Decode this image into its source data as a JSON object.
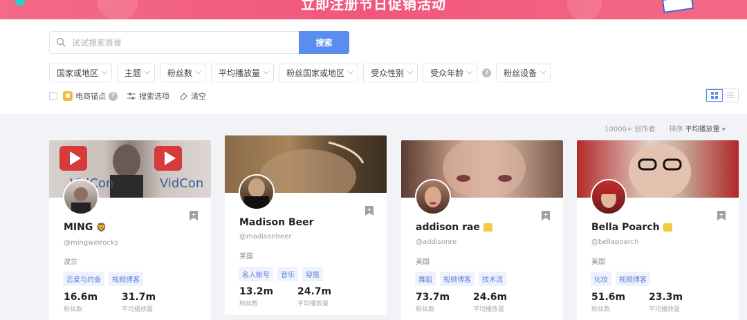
{
  "banner": {
    "title": "立即注册节日促销活动"
  },
  "search": {
    "placeholder": "试试搜索唇膏",
    "button": "搜索"
  },
  "filters": [
    "国家或地区",
    "主题",
    "粉丝数",
    "平均播放量",
    "粉丝国家或地区",
    "受众性别",
    "受众年龄",
    "粉丝设备"
  ],
  "options": {
    "shop": "电商锚点",
    "search_options": "搜索选项",
    "clear": "清空"
  },
  "results": {
    "count": "10000+ 创作者",
    "sort_label": "排序",
    "sort_value": "平均播放量"
  },
  "stat_labels": {
    "followers": "粉丝数",
    "avg_views": "平均播放量"
  },
  "cards": [
    {
      "name": "MING",
      "handle": "@mingweirocks",
      "country": "波兰",
      "tags": [
        "恋爱与约会",
        "视频博客"
      ],
      "followers": "16.6m",
      "avg_views": "31.7m"
    },
    {
      "name": "Madison Beer",
      "handle": "@madisonbeer",
      "country": "美国",
      "tags": [
        "名人帐号",
        "音乐",
        "穿搭"
      ],
      "followers": "13.2m",
      "avg_views": "24.7m"
    },
    {
      "name": "addison rae",
      "handle": "@addisonre",
      "country": "美国",
      "tags": [
        "舞蹈",
        "视频博客",
        "技术流"
      ],
      "followers": "73.7m",
      "avg_views": "24.6m"
    },
    {
      "name": "Bella Poarch",
      "handle": "@bellapoarch",
      "country": "美国",
      "tags": [
        "化妆",
        "视频博客"
      ],
      "followers": "51.6m",
      "avg_views": "23.3m"
    }
  ],
  "colors": {
    "accent": "#5b8def",
    "banner": "#f2577b",
    "tag_text": "#5b7fd6",
    "tag_bg": "#eef2fc"
  }
}
